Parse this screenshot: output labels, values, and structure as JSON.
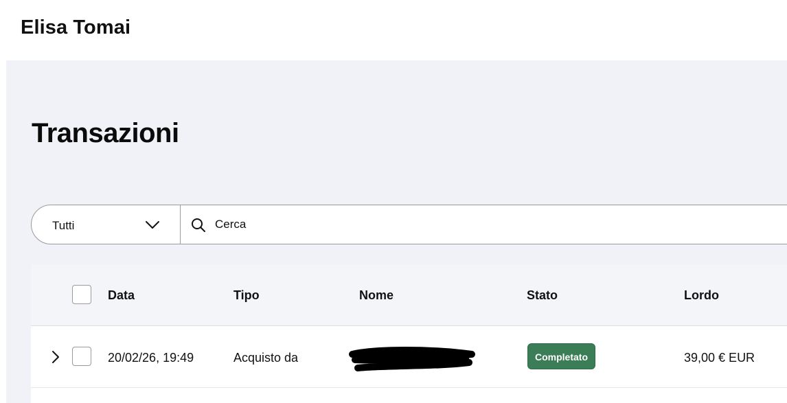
{
  "header": {
    "user_name": "Elisa Tomai"
  },
  "page": {
    "title": "Transazioni"
  },
  "filters": {
    "type_select_value": "Tutti",
    "search_placeholder": "Cerca"
  },
  "table": {
    "columns": [
      "Data",
      "Tipo",
      "Nome",
      "Stato",
      "Lordo"
    ],
    "rows": [
      {
        "data": "20/02/26, 19:49",
        "tipo": "Acquisto da",
        "nome": "",
        "stato": "Completato",
        "lordo": "39,00 € EUR"
      }
    ]
  },
  "colors": {
    "background": "#f1f2f8",
    "status_completed": "#3a7d57"
  },
  "icons": [
    "chevron-down-icon",
    "search-icon",
    "chevron-right-icon"
  ]
}
